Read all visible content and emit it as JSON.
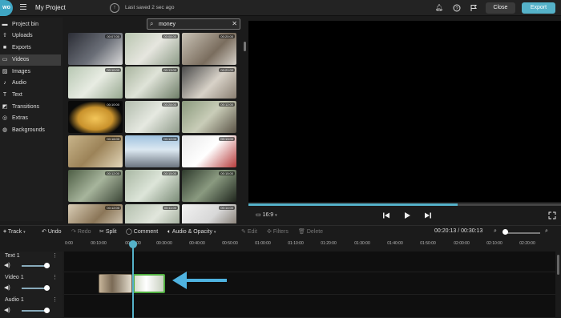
{
  "header": {
    "logo": "wo",
    "project_title": "My Project",
    "save_status": "Last saved 2 sec ago",
    "close_label": "Close",
    "export_label": "Export",
    "accent_color": "#55b2c9"
  },
  "sidebar": {
    "items": [
      {
        "label": "Project bin",
        "icon": "folder-icon"
      },
      {
        "label": "Uploads",
        "icon": "upload-icon"
      },
      {
        "label": "Exports",
        "icon": "export-icon"
      },
      {
        "label": "Videos",
        "icon": "video-icon",
        "active": true
      },
      {
        "label": "Images",
        "icon": "image-icon"
      },
      {
        "label": "Audio",
        "icon": "music-note-icon"
      },
      {
        "label": "Text",
        "icon": "text-icon"
      },
      {
        "label": "Transitions",
        "icon": "transitions-icon"
      },
      {
        "label": "Extras",
        "icon": "extras-icon"
      },
      {
        "label": "Backgrounds",
        "icon": "backgrounds-icon"
      }
    ]
  },
  "media": {
    "search_value": "money",
    "thumbnails": [
      {
        "duration": "00:07:00"
      },
      {
        "duration": "00:08:00"
      },
      {
        "duration": "00:20:00"
      },
      {
        "duration": "00:10:00"
      },
      {
        "duration": "00:13:00"
      },
      {
        "duration": "00:21:00"
      },
      {
        "duration": "00:10:00"
      },
      {
        "duration": "00:28:00"
      },
      {
        "duration": "00:12:00"
      },
      {
        "duration": "00:16:00"
      },
      {
        "duration": "00:12:00"
      },
      {
        "duration": "00:13:00"
      },
      {
        "duration": "00:12:00"
      },
      {
        "duration": "00:15:00"
      },
      {
        "duration": "00:15:00"
      },
      {
        "duration": "00:12:00"
      },
      {
        "duration": "00:11:00"
      },
      {
        "duration": "00:14:00"
      }
    ]
  },
  "preview": {
    "aspect_ratio": "16:9",
    "progress_fraction": 0.67
  },
  "toolbar": {
    "track": "Track",
    "undo": "Undo",
    "redo": "Redo",
    "split": "Split",
    "comment": "Comment",
    "audio_opacity": "Audio & Opacity",
    "edit": "Edit",
    "filters": "Filters",
    "delete": "Delete",
    "timecode": "00:20:13 / 00:30:13"
  },
  "ruler": {
    "ticks": [
      "0:00",
      "00:10:00",
      "00:20:00",
      "00:30:00",
      "00:40:00",
      "00:50:00",
      "01:00:00",
      "01:10:00",
      "01:20:00",
      "01:30:00",
      "01:40:00",
      "01:50:00",
      "02:00:00",
      "02:10:00",
      "02:20:00"
    ]
  },
  "tracks": [
    {
      "name": "Text 1"
    },
    {
      "name": "Video 1"
    },
    {
      "name": "Audio 1"
    }
  ]
}
